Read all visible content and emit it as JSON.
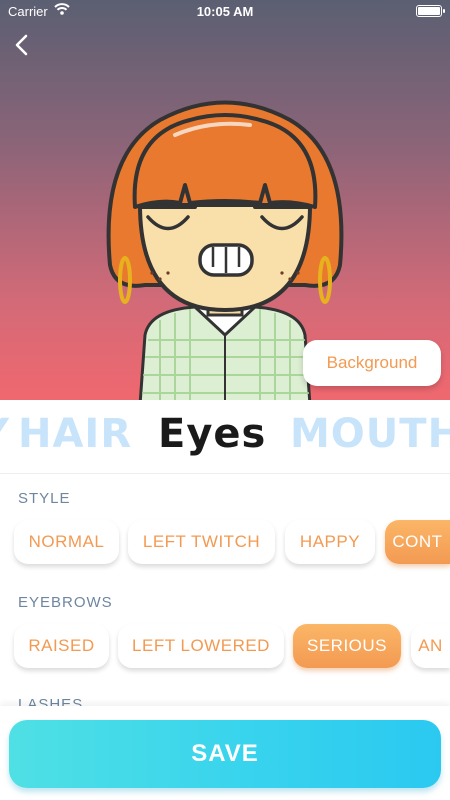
{
  "status_bar": {
    "carrier": "Carrier",
    "time": "10:05 AM"
  },
  "background_button": "Background",
  "categories": [
    {
      "label": "Y",
      "active": false
    },
    {
      "label": "HAIR",
      "active": false
    },
    {
      "label": "Eyes",
      "active": true
    },
    {
      "label": "MOUTH",
      "active": false
    }
  ],
  "sections": {
    "style": {
      "label": "STYLE",
      "options": [
        "NORMAL",
        "LEFT TWITCH",
        "HAPPY",
        "CONT"
      ],
      "selected": "CONT"
    },
    "eyebrows": {
      "label": "EYEBROWS",
      "options": [
        "RAISED",
        "LEFT LOWERED",
        "SERIOUS",
        "AN"
      ],
      "selected": "SERIOUS"
    },
    "lashes": {
      "label": "LASHES"
    }
  },
  "save_label": "SAVE",
  "colors": {
    "accent": "#f39a52",
    "save": "#36d2ee",
    "tab_inactive": "#c8e4fb",
    "label": "#6e86a0"
  },
  "icons": {
    "back": "chevron-left-icon",
    "wifi": "wifi-icon",
    "battery": "battery-icon"
  }
}
